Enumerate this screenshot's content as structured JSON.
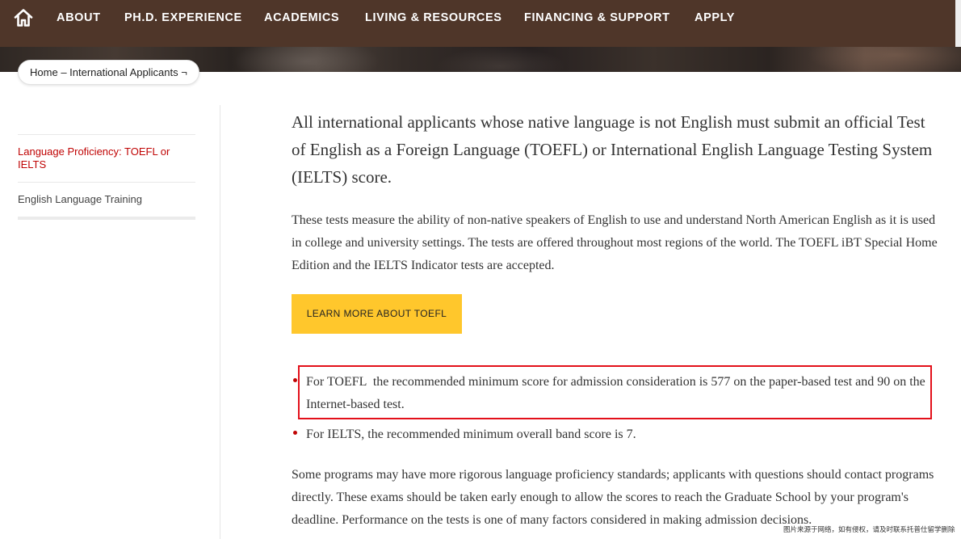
{
  "nav": {
    "home_icon": "home-icon",
    "items": [
      {
        "label": "ABOUT"
      },
      {
        "label": "PH.D. EXPERIENCE"
      },
      {
        "label": "ACADEMICS"
      },
      {
        "label": "LIVING & RESOURCES"
      },
      {
        "label": "FINANCING & SUPPORT"
      },
      {
        "label": "APPLY"
      }
    ]
  },
  "breadcrumb": {
    "home": "Home",
    "separator": "–",
    "current": "International Applicants",
    "dropdown_toggle": "¬"
  },
  "sidebar": {
    "items": [
      {
        "label": "Language Proficiency: TOEFL or IELTS",
        "active": true
      },
      {
        "label": "English Language Training",
        "active": false
      }
    ]
  },
  "main": {
    "lead": "All international applicants whose native language is not English must submit an official Test of English as a Foreign Language (TOEFL) or International English Language Testing System (IELTS) score.",
    "intro": "These tests measure the ability of non-native speakers of English to use and understand North American English as it is used in college and university settings. The tests are offered throughout most regions of the world. The TOEFL iBT Special Home Edition and the IELTS Indicator tests are accepted.",
    "cta_button": "LEARN MORE ABOUT TOEFL",
    "requirements": [
      "For TOEFL  the recommended minimum score for admission consideration is 577 on the paper-based test and 90 on the Internet-based test.",
      "For IELTS, the recommended minimum overall band score is 7."
    ],
    "note": "Some programs may have more rigorous language proficiency standards; applicants with questions should contact programs directly. These exams should be taken early enough to allow the scores to reach the Graduate School by your program's deadline. Performance on the tests is one of many factors considered in making admission decisions."
  },
  "watermark": "图片来源于网络，如有侵权，请及时联系托普仕留学删除",
  "colors": {
    "nav_bg": "#4f3629",
    "accent": "#c00404",
    "button_bg": "#ffc72c",
    "annotation": "#e3101a"
  }
}
